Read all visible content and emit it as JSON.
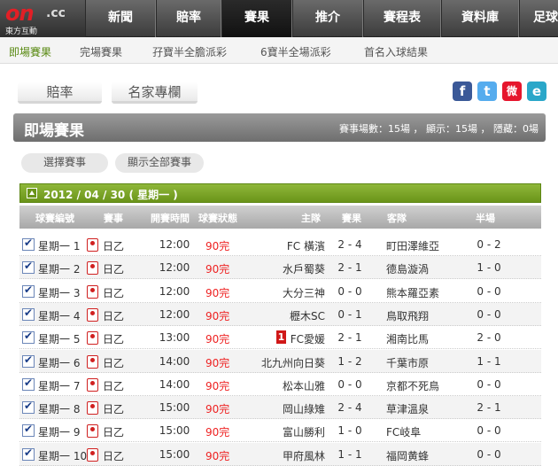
{
  "logo": {
    "brand": "on",
    "tld": ".cc",
    "name": "東方互動"
  },
  "nav": [
    {
      "label": "新聞"
    },
    {
      "label": "賠率"
    },
    {
      "label": "賽果"
    },
    {
      "label": "推介"
    },
    {
      "label": "賽程表"
    },
    {
      "label": "資料庫"
    },
    {
      "label": "足球"
    }
  ],
  "subnav": [
    {
      "label": "即場賽果"
    },
    {
      "label": "完場賽果"
    },
    {
      "label": "孖寶半全膽派彩"
    },
    {
      "label": "6寶半全場派彩"
    },
    {
      "label": "首名入球結果"
    }
  ],
  "tabs": [
    {
      "label": "賠率"
    },
    {
      "label": "名家專欄"
    }
  ],
  "social": [
    {
      "icon": "facebook-icon",
      "glyph": "f",
      "color": "#3b5998"
    },
    {
      "icon": "twitter-icon",
      "glyph": "t",
      "color": "#55acee"
    },
    {
      "icon": "weibo-icon",
      "glyph": "微",
      "color": "#e6162d"
    },
    {
      "icon": "share-icon",
      "glyph": "e",
      "color": "#2aa7c9"
    }
  ],
  "section": {
    "title": "即場賽果",
    "stats": "賽事場數：15場 ， 顯示：15場 ， 隱藏：0場"
  },
  "buttons": {
    "select": "選擇賽事",
    "show_all": "顯示全部賽事"
  },
  "date": "2012 / 04 / 30 ( 星期一 )",
  "headers": [
    "球賽編號",
    "賽事",
    "開賽時間",
    "球賽狀態",
    "主隊",
    "賽果",
    "客隊",
    "半場"
  ],
  "matches": [
    {
      "no": "星期一 1",
      "league": "日乙",
      "time": "12:00",
      "status": "90完",
      "home": "FC 橫濱",
      "score": "2 - 4",
      "away": "町田澤維亞",
      "half": "0 - 2"
    },
    {
      "no": "星期一 2",
      "league": "日乙",
      "time": "12:00",
      "status": "90完",
      "home": "水戶蜀葵",
      "score": "2 - 1",
      "away": "德島漩渦",
      "half": "1 - 0"
    },
    {
      "no": "星期一 3",
      "league": "日乙",
      "time": "12:00",
      "status": "90完",
      "home": "大分三神",
      "score": "0 - 0",
      "away": "熊本羅亞素",
      "half": "0 - 0"
    },
    {
      "no": "星期一 4",
      "league": "日乙",
      "time": "12:00",
      "status": "90完",
      "home": "櫪木SC",
      "score": "0 - 1",
      "away": "鳥取飛翔",
      "half": "0 - 0"
    },
    {
      "no": "星期一 5",
      "league": "日乙",
      "time": "13:00",
      "status": "90完",
      "home": "FC愛媛",
      "score": "2 - 1",
      "away": "湘南比馬",
      "half": "2 - 0",
      "redcard": "1"
    },
    {
      "no": "星期一 6",
      "league": "日乙",
      "time": "14:00",
      "status": "90完",
      "home": "北九州向日葵",
      "score": "1 - 2",
      "away": "千葉市原",
      "half": "1 - 1"
    },
    {
      "no": "星期一 7",
      "league": "日乙",
      "time": "14:00",
      "status": "90完",
      "home": "松本山雅",
      "score": "0 - 0",
      "away": "京都不死鳥",
      "half": "0 - 0"
    },
    {
      "no": "星期一 8",
      "league": "日乙",
      "time": "15:00",
      "status": "90完",
      "home": "岡山綠雉",
      "score": "2 - 4",
      "away": "草津溫泉",
      "half": "2 - 1"
    },
    {
      "no": "星期一 9",
      "league": "日乙",
      "time": "15:00",
      "status": "90完",
      "home": "富山勝利",
      "score": "1 - 0",
      "away": "FC岐阜",
      "half": "0 - 0"
    },
    {
      "no": "星期一 10",
      "league": "日乙",
      "time": "15:00",
      "status": "90完",
      "home": "甲府風林",
      "score": "1 - 1",
      "away": "福岡黄蜂",
      "half": "0 - 0"
    }
  ]
}
